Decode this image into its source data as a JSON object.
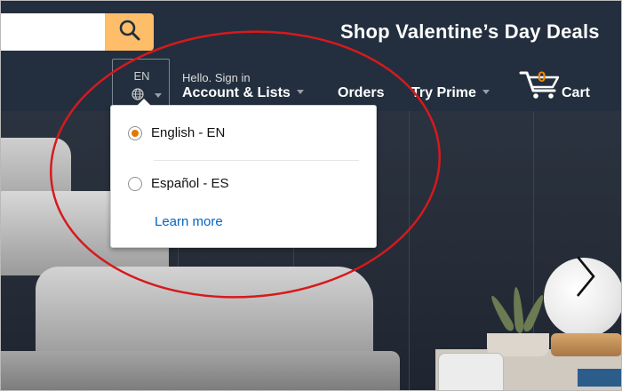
{
  "header": {
    "promo": "Shop Valentine’s Day Deals",
    "search_icon": "search-icon"
  },
  "nav": {
    "lang_code": "EN",
    "lang_icon": "globe-icon",
    "greeting": "Hello. Sign in",
    "account": "Account & Lists",
    "orders": "Orders",
    "prime": "Try Prime",
    "cart_count": "0",
    "cart_label": "Cart"
  },
  "language_menu": {
    "options": [
      {
        "label": "English - EN",
        "selected": true
      },
      {
        "label": "Español - ES",
        "selected": false
      }
    ],
    "learn_more": "Learn more"
  },
  "colors": {
    "nav_bg": "#232f3e",
    "search_button": "#febd69",
    "accent_orange": "#f08804",
    "radio_selected": "#e77600",
    "link": "#0066c0",
    "annotation": "#d7191c"
  }
}
